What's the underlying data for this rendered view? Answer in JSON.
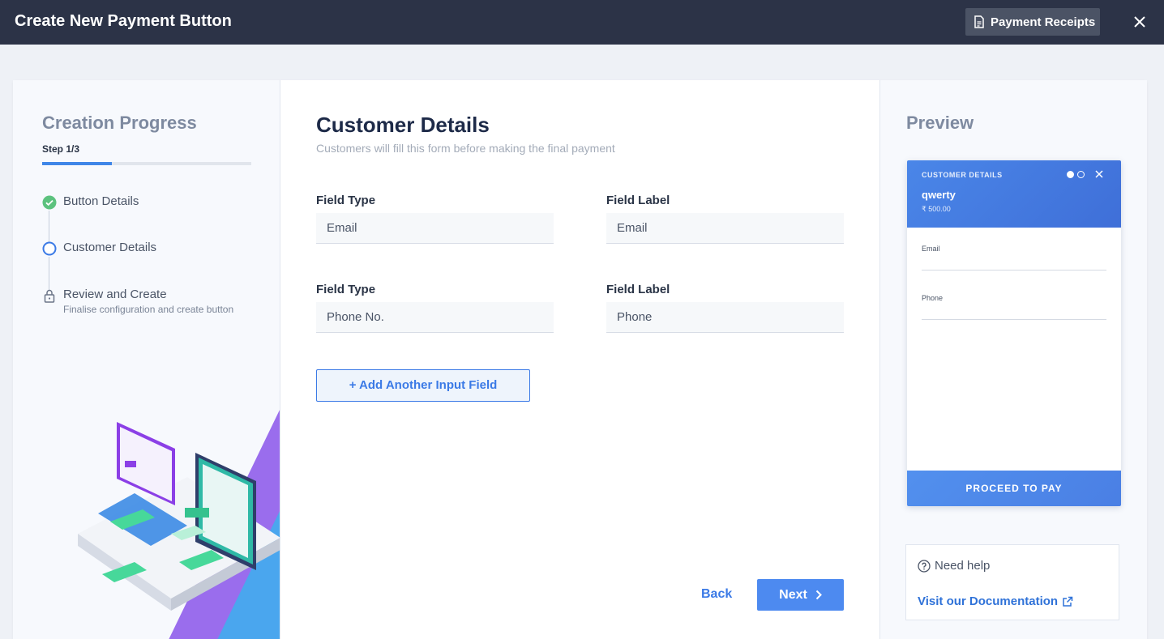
{
  "header": {
    "title": "Create New Payment Button",
    "receipts_label": "Payment Receipts"
  },
  "progress": {
    "title": "Creation Progress",
    "step_label": "Step 1/3",
    "progress_fraction": 0.333,
    "steps": [
      {
        "label": "Button Details",
        "status": "complete",
        "sub": ""
      },
      {
        "label": "Customer Details",
        "status": "current",
        "sub": ""
      },
      {
        "label": "Review and Create",
        "status": "locked",
        "sub": "Finalise configuration and create button"
      }
    ]
  },
  "form": {
    "title": "Customer Details",
    "subtitle": "Customers will fill this form before making the final payment",
    "rows": [
      {
        "type_label": "Field Type",
        "type_value": "Email",
        "label_label": "Field Label",
        "label_value": "Email"
      },
      {
        "type_label": "Field Type",
        "type_value": "Phone No.",
        "label_label": "Field Label",
        "label_value": "Phone"
      }
    ],
    "add_button": "+ Add Another Input Field",
    "back_label": "Back",
    "next_label": "Next"
  },
  "preview": {
    "title": "Preview",
    "header_label": "CUSTOMER DETAILS",
    "name": "qwerty",
    "amount": "₹ 500.00",
    "fields": [
      "Email",
      "Phone"
    ],
    "pay_button": "PROCEED TO PAY"
  },
  "help": {
    "title": "Need help",
    "link": "Visit our Documentation"
  },
  "colors": {
    "topbar": "#2c3347",
    "accent": "#3b7ae6",
    "success": "#5cc27e"
  }
}
